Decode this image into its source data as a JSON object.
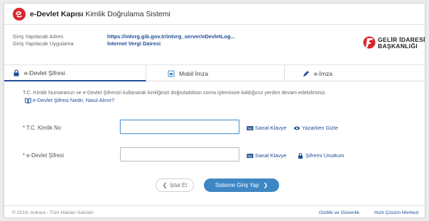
{
  "header": {
    "title_bold": "e-Devlet Kapısı",
    "title_rest": " Kimlik Doğrulama Sistemi"
  },
  "info": {
    "address_label": "Giriş Yapılacak Adres",
    "address_value": "https://intvrg.gib.gov.tr/intvrg_server/eDevletLog...",
    "app_label": "Giriş Yapılacak Uygulama",
    "app_value": "İnternet Vergi Dairesi"
  },
  "gib_logo": {
    "line1": "GELİR İDARESİ",
    "line2": "BAŞKANLIĞI"
  },
  "tabs": [
    {
      "label": "e-Devlet Şifresi",
      "icon": "lock-icon",
      "active": true
    },
    {
      "label": "Mobil İmza",
      "icon": "sim-card-icon",
      "active": false
    },
    {
      "label": "e-İmza",
      "icon": "pen-icon",
      "active": false
    }
  ],
  "description": "T.C. Kimlik Numaranızı ve e-Devlet Şifrenizi kullanarak kimliğinizi doğruladıktan sonra işleminize kaldığınız yerden devam edebilirsiniz.",
  "help_link": "e-Devlet Şifresi Nedir, Nasıl Alınır?",
  "form": {
    "tc_label": "* T.C. Kimlik No",
    "tc_value": "",
    "password_label": "* e-Devlet Şifresi",
    "password_value": "",
    "virtual_keyboard": "Sanal Klavye",
    "hide_while_typing": "Yazarken Gizle",
    "forgot_password": "Şifremi Unuttum"
  },
  "buttons": {
    "cancel": "İptal Et",
    "login": "Sisteme Giriş Yap"
  },
  "footer": {
    "copyright": "© 2019, Ankara - Tüm Hakları Saklıdır",
    "privacy": "Gizlilik ve Güvenlik",
    "help": "Hızlı Çözüm Merkezi"
  },
  "colors": {
    "brand_red": "#d8262e",
    "link_blue": "#1f4e97",
    "button_blue": "#3d87c4"
  }
}
